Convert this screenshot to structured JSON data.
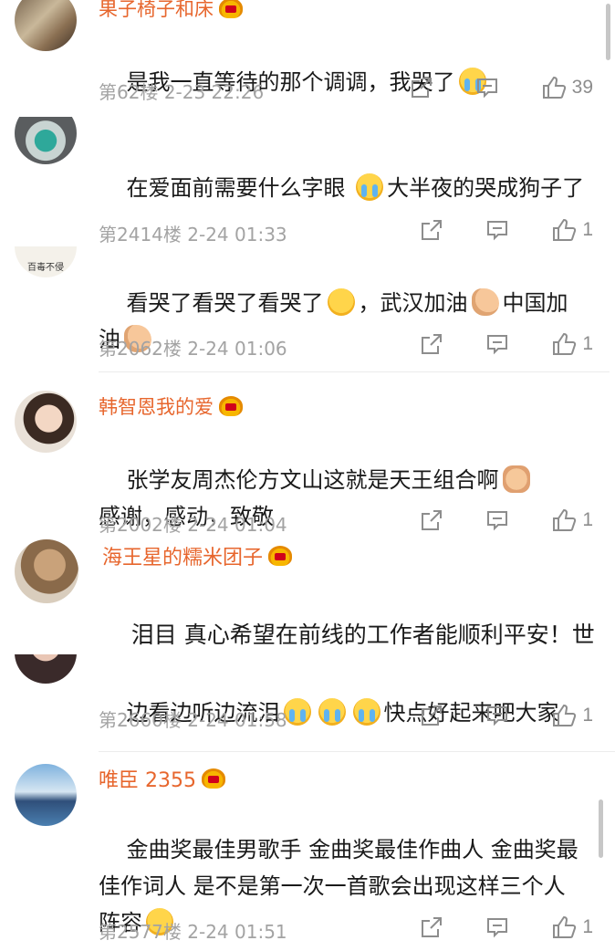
{
  "comments": [
    {
      "username": "果子椅子和床",
      "segments": [
        {
          "t": "是我一直等待的那个调调，我哭了"
        },
        {
          "e": "cry"
        }
      ],
      "floor": "第62楼",
      "time": "2-23 22:26",
      "likes": "39"
    },
    {
      "username": "",
      "segments": [
        {
          "t": "在爱面前需要什么字眼 "
        },
        {
          "e": "cry"
        },
        {
          "t": "大半夜的哭成狗子了"
        }
      ],
      "floor": "第2414楼",
      "time": "2-24 01:33",
      "likes": "1"
    },
    {
      "username": "",
      "segments": [
        {
          "t": "看哭了看哭了看哭了"
        },
        {
          "e": "sad"
        },
        {
          "t": "，武汉加油"
        },
        {
          "e": "arm"
        },
        {
          "t": "中国加油"
        },
        {
          "e": "arm"
        }
      ],
      "floor": "第2062楼",
      "time": "2-24 01:06",
      "likes": "1",
      "avatar_text": "百毒不侵"
    },
    {
      "username": "韩智恩我的爱",
      "segments": [
        {
          "t": "张学友周杰伦方文山这就是天王组合啊"
        },
        {
          "e": "thumb"
        },
        {
          "t": "感谢，感动，致敬"
        }
      ],
      "floor": "第2002楼",
      "time": "2-24 01:04",
      "likes": "1"
    },
    {
      "username": "海王星的糯米团子",
      "segments": [
        {
          "t": "泪目 真心希望在前线的工作者能顺利平安！世界加油！中国加油！武汉加油！"
        }
      ]
    },
    {
      "username": "",
      "segments": [
        {
          "t": "边看边听边流泪"
        },
        {
          "e": "cry"
        },
        {
          "e": "cry"
        },
        {
          "e": "cry"
        },
        {
          "t": "快点好起来吧大家"
        }
      ],
      "floor": "第2660楼",
      "time": "2-24 01:58",
      "likes": "1"
    },
    {
      "username": "唯臣 2355",
      "segments": [
        {
          "t": "金曲奖最佳男歌手 金曲奖最佳作曲人 金曲奖最佳作词人 是不是第一次一首歌会出现这样三个人阵容"
        },
        {
          "e": "wow"
        }
      ],
      "floor": "第2577楼",
      "time": "2-24 01:51",
      "likes": "1"
    }
  ],
  "colors": {
    "username": "#e7662d",
    "meta": "#a3a3a3",
    "icon": "#8d8d8d"
  },
  "icons": [
    "share-icon",
    "comment-icon",
    "like-icon",
    "crown-badge-icon",
    "cry-emoji",
    "flex-arm-emoji",
    "thumbs-up-emoji",
    "shocked-emoji"
  ]
}
